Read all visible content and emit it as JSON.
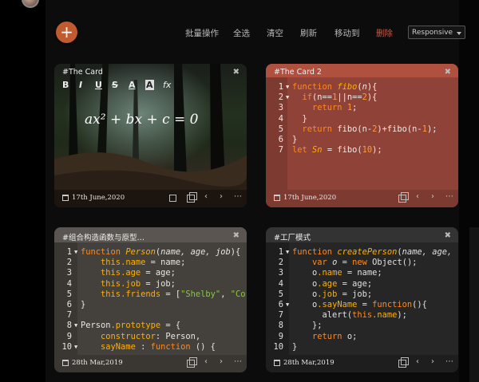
{
  "toolbar": {
    "add": "+",
    "batch": "批量操作",
    "select_all": "全选",
    "clear": "清空",
    "refresh": "刷新",
    "move_to": "移动到",
    "delete": "删除",
    "layout_select": "Responsive"
  },
  "cards": [
    {
      "title": "#The Card",
      "date": "17th June,2020",
      "formula": "ax² + bx + c = 0",
      "format_buttons": [
        "B",
        "I",
        "U",
        "S",
        "A",
        "A",
        "fx"
      ]
    },
    {
      "title": "#The Card 2",
      "date": "17th June,2020",
      "line_numbers": [
        "1",
        "2",
        "3",
        "4",
        "5",
        "6",
        "7"
      ]
    },
    {
      "title": "#组合构造函数与原型…",
      "date": "28th Mar,2019",
      "line_numbers": [
        "1",
        "2",
        "3",
        "4",
        "5",
        "6",
        "7",
        "8",
        "9",
        "10"
      ]
    },
    {
      "title": "#工厂模式",
      "date": "28th Mar,2019",
      "line_numbers": [
        "1",
        "2",
        "3",
        "4",
        "5",
        "6",
        "7",
        "8",
        "9",
        "10"
      ]
    }
  ],
  "code_text": {
    "c2": {
      "l1a": "function",
      "l1b": "fibo",
      "l1c": "(",
      "l1d": "n",
      "l1e": "){",
      "l2a": "if",
      "l2b": "(n==",
      "l2c": "1",
      "l2d": "||n==",
      "l2e": "2",
      "l2f": "){",
      "l3a": "return",
      "l3b": "1",
      "l3c": ";",
      "l4a": "}",
      "l5a": "return",
      "l5b": "fibo(n-",
      "l5c": "2",
      "l5d": ")+fibo(n-",
      "l5e": "1",
      "l5f": ");",
      "l6a": "}",
      "l7a": "let",
      "l7b": "Sn",
      "l7c": "= fibo(",
      "l7d": "10",
      "l7e": ");"
    },
    "c3": {
      "l1a": "function",
      "l1b": "Person",
      "l1c": "(",
      "l1d": "name, age, job",
      "l1e": "){",
      "l2a": "this",
      "l2b": ".name",
      "l2c": " = name;",
      "l3a": "this",
      "l3b": ".age",
      "l3c": " = age;",
      "l4a": "this",
      "l4b": ".job",
      "l4c": " = job;",
      "l5a": "this",
      "l5b": ".friends",
      "l5c": " = [",
      "l5d": "\"Shelby\"",
      "l5e": ", ",
      "l5f": "\"Co",
      "l6a": "}",
      "l8a": "Person",
      "l8b": ".prototype",
      "l8c": " = {",
      "l9a": "constructor",
      "l9b": ": Person,",
      "l10a": "sayName",
      "l10b": " : ",
      "l10c": "function",
      "l10d": " () {"
    },
    "c4": {
      "l1a": "function",
      "l1b": "createPerson",
      "l1c": "(",
      "l1d": "name, age,",
      "l2a": "var",
      "l2b": "o",
      "l2c": " = ",
      "l2d": "new",
      "l2e": " Object();",
      "l3a": "o",
      "l3b": ".name",
      "l3c": " = name;",
      "l4a": "o",
      "l4b": ".age",
      "l4c": " = age;",
      "l5a": "o",
      "l5b": ".job",
      "l5c": " = job;",
      "l6a": "o",
      "l6b": ".sayName",
      "l6c": " = ",
      "l6d": "function",
      "l6e": "(){",
      "l7a": "alert(",
      "l7b": "this",
      "l7c": ".name",
      "l7d": ");",
      "l8a": "};",
      "l9a": "return",
      "l9b": " o;",
      "l10a": "}"
    }
  },
  "colors": {
    "accent": "#c15a2e",
    "card2_bg": "#8e4238",
    "card3_bg": "#44403c",
    "card4_bg": "#262626"
  }
}
